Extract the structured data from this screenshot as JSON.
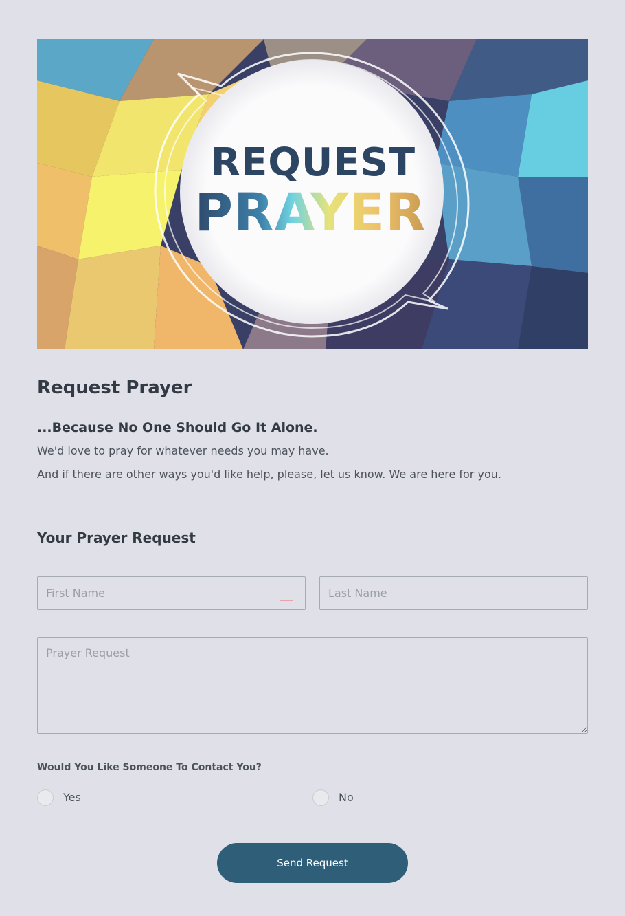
{
  "hero": {
    "word_1": "REQUEST",
    "word_2": "PRAYER"
  },
  "page_title": "Request Prayer",
  "tagline": "...Because No One Should Go It Alone.",
  "intro": {
    "line_1": "We'd love to pray for whatever needs you may have.",
    "line_2": "And if there are other ways you'd like help, please, let us know. We are here for you."
  },
  "form": {
    "section_title": "Your Prayer Request",
    "first_name": {
      "placeholder": "First Name",
      "value": ""
    },
    "last_name": {
      "placeholder": "Last Name",
      "value": ""
    },
    "prayer_request": {
      "placeholder": "Prayer Request",
      "value": ""
    },
    "contact_question": "Would You Like Someone To Contact You?",
    "options": [
      "Yes",
      "No"
    ],
    "submit_label": "Send Request"
  },
  "colors": {
    "page_background": "#e0e1e8",
    "button": "#2f5f78",
    "heading": "#333a44"
  }
}
